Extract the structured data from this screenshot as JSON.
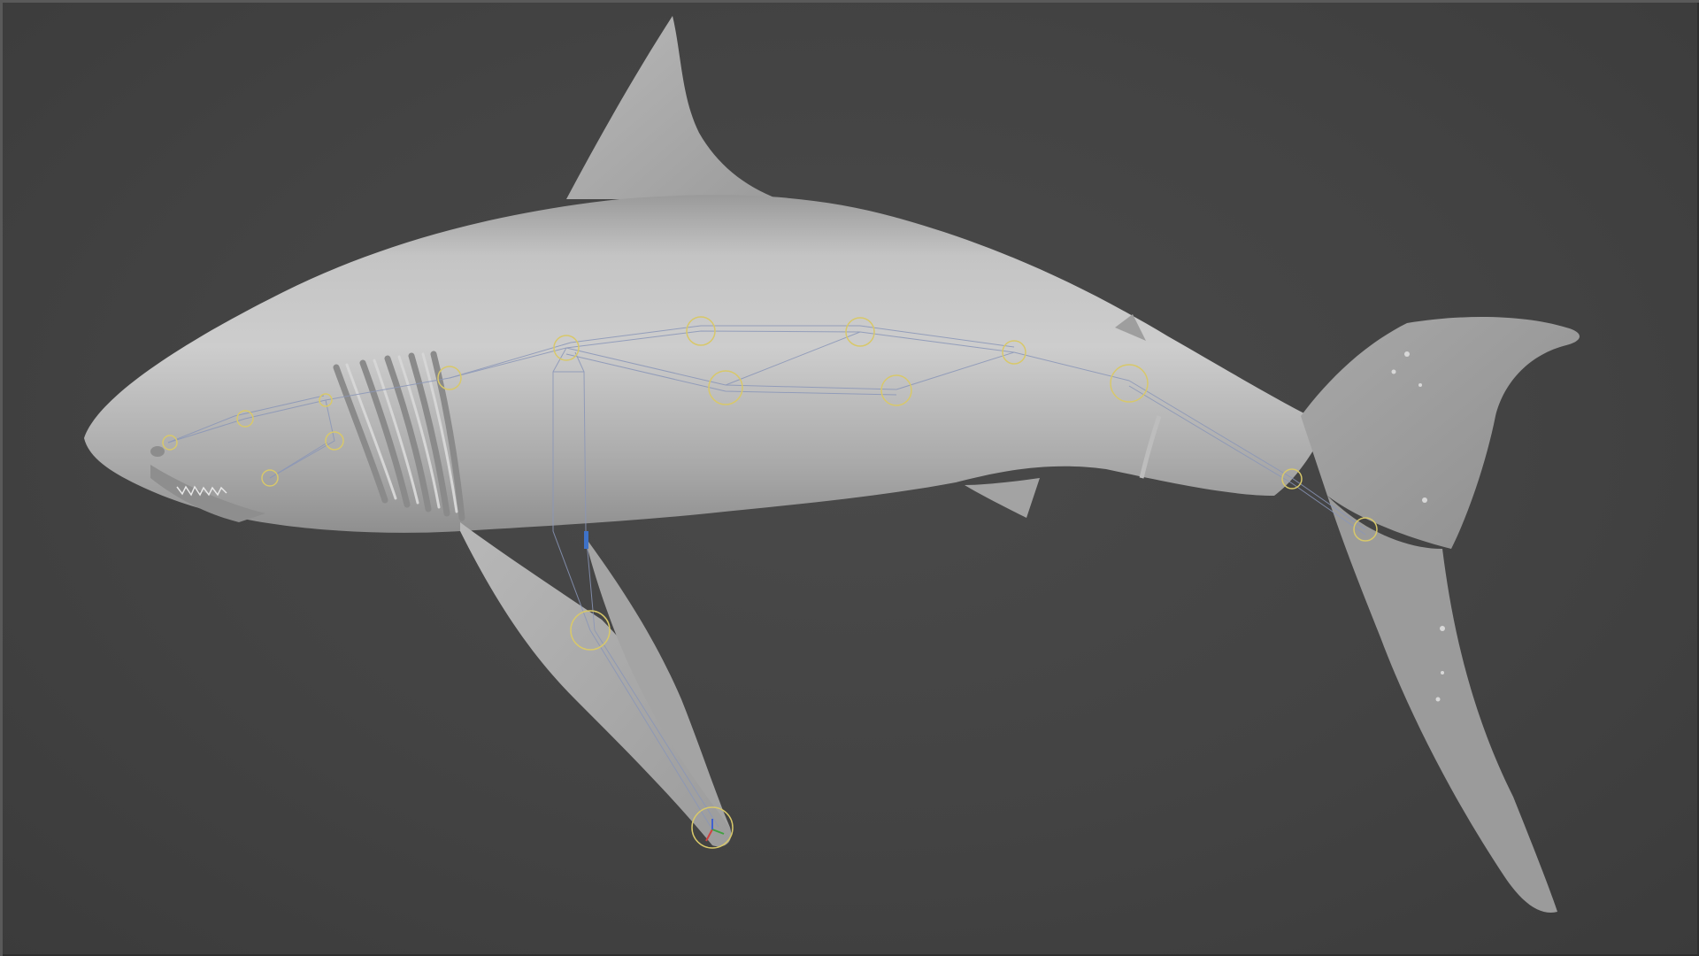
{
  "viewport": {
    "background": "#434343",
    "model_color": "#b4b4b4",
    "bone_color": "#8a96b8",
    "joint_color": "#d8c86a",
    "shading_mode": "solid",
    "bone_count": 22
  }
}
